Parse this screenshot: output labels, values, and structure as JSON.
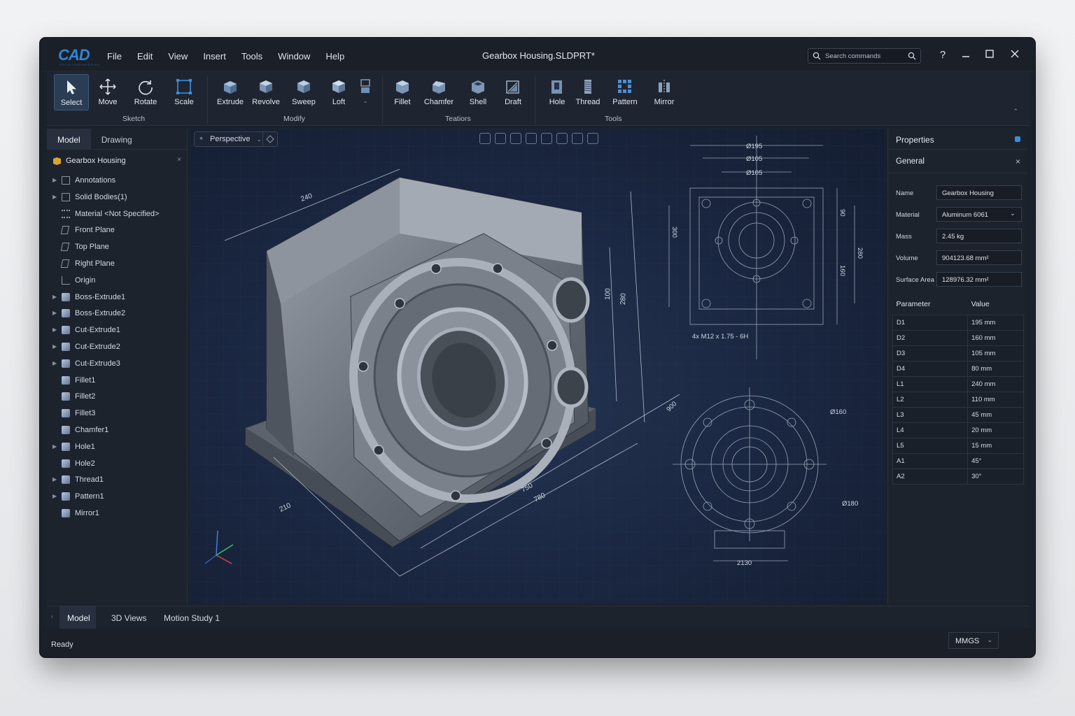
{
  "app": {
    "logo": "CAD",
    "logo_sub": "SOLID·ENGINEERING",
    "title": "Gearbox Housing.SLDPRT*"
  },
  "menu": [
    "File",
    "Edit",
    "View",
    "Insert",
    "Tools",
    "Window",
    "Help"
  ],
  "search": {
    "placeholder": "Search commands"
  },
  "window_controls": {
    "help": "?",
    "minimize": "minimize-icon",
    "maximize": "maximize-icon",
    "close": "close-icon"
  },
  "ribbon": {
    "sketch": {
      "label": "Sketch",
      "tools": [
        "Select",
        "Move",
        "Rotate",
        "Scale"
      ]
    },
    "modify": {
      "label": "Modify",
      "tools": [
        "Extrude",
        "Revolve",
        "Sweep",
        "Loft"
      ]
    },
    "features": {
      "label": "Teatiors",
      "tools": [
        "Fillet",
        "Chamfer",
        "Shell",
        "Draft"
      ]
    },
    "tools": {
      "label": "Tools",
      "tools": [
        "Hole",
        "Thread",
        "Pattern",
        "Mirror"
      ]
    }
  },
  "left_panel": {
    "tabs": [
      "Model",
      "Drawing"
    ],
    "root": "Gearbox Housing",
    "items": [
      {
        "label": "Annotations",
        "expandable": true,
        "icon": "folder-icon"
      },
      {
        "label": "Solid Bodies(1)",
        "expandable": true,
        "icon": "folder-icon"
      },
      {
        "label": "Material <Not Specified>",
        "expandable": false,
        "icon": "material-icon"
      },
      {
        "label": "Front Plane",
        "expandable": false,
        "icon": "plane-icon"
      },
      {
        "label": "Top Plane",
        "expandable": false,
        "icon": "plane-icon"
      },
      {
        "label": "Right Plane",
        "expandable": false,
        "icon": "plane-icon"
      },
      {
        "label": "Origin",
        "expandable": false,
        "icon": "origin-icon"
      },
      {
        "label": "Boss-Extrude1",
        "expandable": true,
        "icon": "feature-icon"
      },
      {
        "label": "Boss-Extrude2",
        "expandable": true,
        "icon": "feature-icon"
      },
      {
        "label": "Cut-Extrude1",
        "expandable": true,
        "icon": "feature-icon"
      },
      {
        "label": "Cut-Extrude2",
        "expandable": true,
        "icon": "feature-icon"
      },
      {
        "label": "Cut-Extrude3",
        "expandable": true,
        "icon": "feature-icon"
      },
      {
        "label": "Fillet1",
        "expandable": false,
        "icon": "feature-icon"
      },
      {
        "label": "Fillet2",
        "expandable": false,
        "icon": "feature-icon"
      },
      {
        "label": "Fillet3",
        "expandable": false,
        "icon": "feature-icon"
      },
      {
        "label": "Chamfer1",
        "expandable": false,
        "icon": "feature-icon"
      },
      {
        "label": "Hole1",
        "expandable": true,
        "icon": "feature-icon"
      },
      {
        "label": "Hole2",
        "expandable": false,
        "icon": "feature-icon"
      },
      {
        "label": "Thread1",
        "expandable": true,
        "icon": "feature-icon"
      },
      {
        "label": "Pattern1",
        "expandable": true,
        "icon": "pattern-icon"
      },
      {
        "label": "Mirror1",
        "expandable": false,
        "icon": "mirror-icon"
      }
    ]
  },
  "viewport": {
    "view_mode": "Perspective",
    "dims_iso": [
      "240",
      "100",
      "280",
      "750",
      "780",
      "210",
      "780"
    ],
    "drawing_front": {
      "d1": "Ø195",
      "d2": "Ø105",
      "d3": "Ø105",
      "h1": "300",
      "h2": "90",
      "h3": "280",
      "h4": "160",
      "thread": "4x M12 x 1.75 - 6H"
    },
    "drawing_top": {
      "d1": "Ø160",
      "d2": "Ø180",
      "w": "2130",
      "a1": "900"
    }
  },
  "properties": {
    "title": "Properties",
    "section": "General",
    "fields": [
      {
        "label": "Name",
        "value": "Gearbox Housing"
      },
      {
        "label": "Material",
        "value": "Aluminum 6061",
        "dropdown": true
      },
      {
        "label": "Mass",
        "value": "2.45 kg"
      },
      {
        "label": "Volume",
        "value": "904123.68 mm²"
      },
      {
        "label": "Surface Area",
        "value": "128976.32 mm²"
      }
    ],
    "table_headers": [
      "Parameter",
      "Value"
    ],
    "table": [
      [
        "D1",
        "195 mm"
      ],
      [
        "D2",
        "160 mm"
      ],
      [
        "D3",
        "105 mm"
      ],
      [
        "D4",
        "80 mm"
      ],
      [
        "L1",
        "240 mm"
      ],
      [
        "L2",
        "110 mm"
      ],
      [
        "L3",
        "45 mm"
      ],
      [
        "L4",
        "20 mm"
      ],
      [
        "L5",
        "15 mm"
      ],
      [
        "A1",
        "45°"
      ],
      [
        "A2",
        "30°"
      ]
    ]
  },
  "bottom_tabs": [
    "Model",
    "3D Views",
    "Motion Study 1"
  ],
  "status": {
    "text": "Ready",
    "units": "MMGS"
  }
}
